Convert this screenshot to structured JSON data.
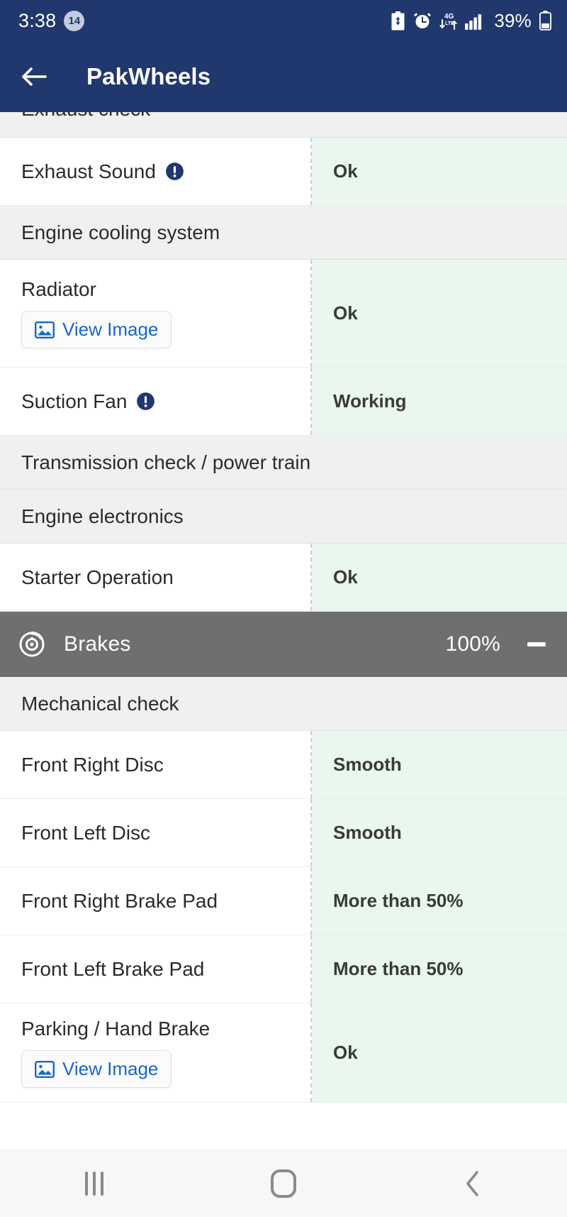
{
  "status_bar": {
    "time": "3:38",
    "notification_count": "14",
    "battery_percent": "39%",
    "icons": [
      "battery-saver-icon",
      "alarm-icon",
      "mobile-data-icon",
      "signal-bars-icon",
      "battery-icon"
    ]
  },
  "app_bar": {
    "title": "PakWheels",
    "back_icon": "back-arrow-icon"
  },
  "colors": {
    "brand_navy": "#21386e",
    "value_green_bg": "#e9f7ee",
    "section_grey": "#f0f0f0",
    "category_grey": "#6f6f6f",
    "link_blue": "#1a66cc"
  },
  "content": {
    "blocks": [
      {
        "kind": "sub-head",
        "clipped": true,
        "label": "Exhaust check"
      },
      {
        "kind": "row",
        "label": "Exhaust Sound",
        "info": true,
        "value": "Ok"
      },
      {
        "kind": "sub-head",
        "label": "Engine cooling system"
      },
      {
        "kind": "row",
        "label": "Radiator",
        "info": false,
        "view_image": "View Image",
        "value": "Ok"
      },
      {
        "kind": "row",
        "label": "Suction Fan",
        "info": true,
        "value": "Working"
      },
      {
        "kind": "sub-head",
        "label": "Transmission check / power train"
      },
      {
        "kind": "sub-head",
        "label": "Engine electronics"
      },
      {
        "kind": "row",
        "label": "Starter Operation",
        "info": false,
        "value": "Ok"
      },
      {
        "kind": "category",
        "icon": "brake-disc-icon",
        "label": "Brakes",
        "percent": "100%",
        "toggle": "collapse-minus-icon"
      },
      {
        "kind": "sub-head",
        "label": "Mechanical check"
      },
      {
        "kind": "row",
        "label": "Front Right Disc",
        "info": false,
        "value": "Smooth"
      },
      {
        "kind": "row",
        "label": "Front Left Disc",
        "info": false,
        "value": "Smooth"
      },
      {
        "kind": "row",
        "label": "Front Right Brake Pad",
        "info": false,
        "value": "More than 50%"
      },
      {
        "kind": "row",
        "label": "Front Left Brake Pad",
        "info": false,
        "value": "More than 50%"
      },
      {
        "kind": "row",
        "label": "Parking / Hand Brake",
        "info": false,
        "view_image": "View Image",
        "value": "Ok"
      }
    ]
  },
  "nav_bar": {
    "recents": "recent-apps-icon",
    "home": "home-icon",
    "back": "back-icon"
  }
}
